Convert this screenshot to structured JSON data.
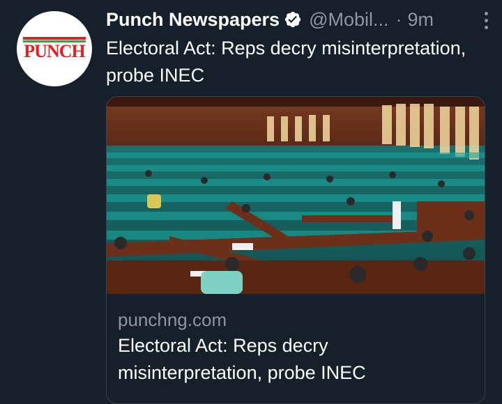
{
  "account": {
    "display_name": "Punch Newspapers",
    "handle": "@Mobil...",
    "separator": "·",
    "time_ago": "9m",
    "avatar_logo_text": "PUNCH"
  },
  "tweet": {
    "text": "Electoral Act: Reps decry misinterpretation, probe INEC"
  },
  "card": {
    "domain": "punchng.com",
    "title": "Electoral Act: Reps decry misinterpretation, probe INEC"
  },
  "icons": {
    "verified": "verified-badge-icon",
    "more": "more-options-icon"
  },
  "colors": {
    "background": "#15202b",
    "text_primary": "#ffffff",
    "text_secondary": "#8b98a5",
    "border": "#38444d",
    "punch_red": "#e31e24",
    "punch_green": "#3aa142"
  }
}
